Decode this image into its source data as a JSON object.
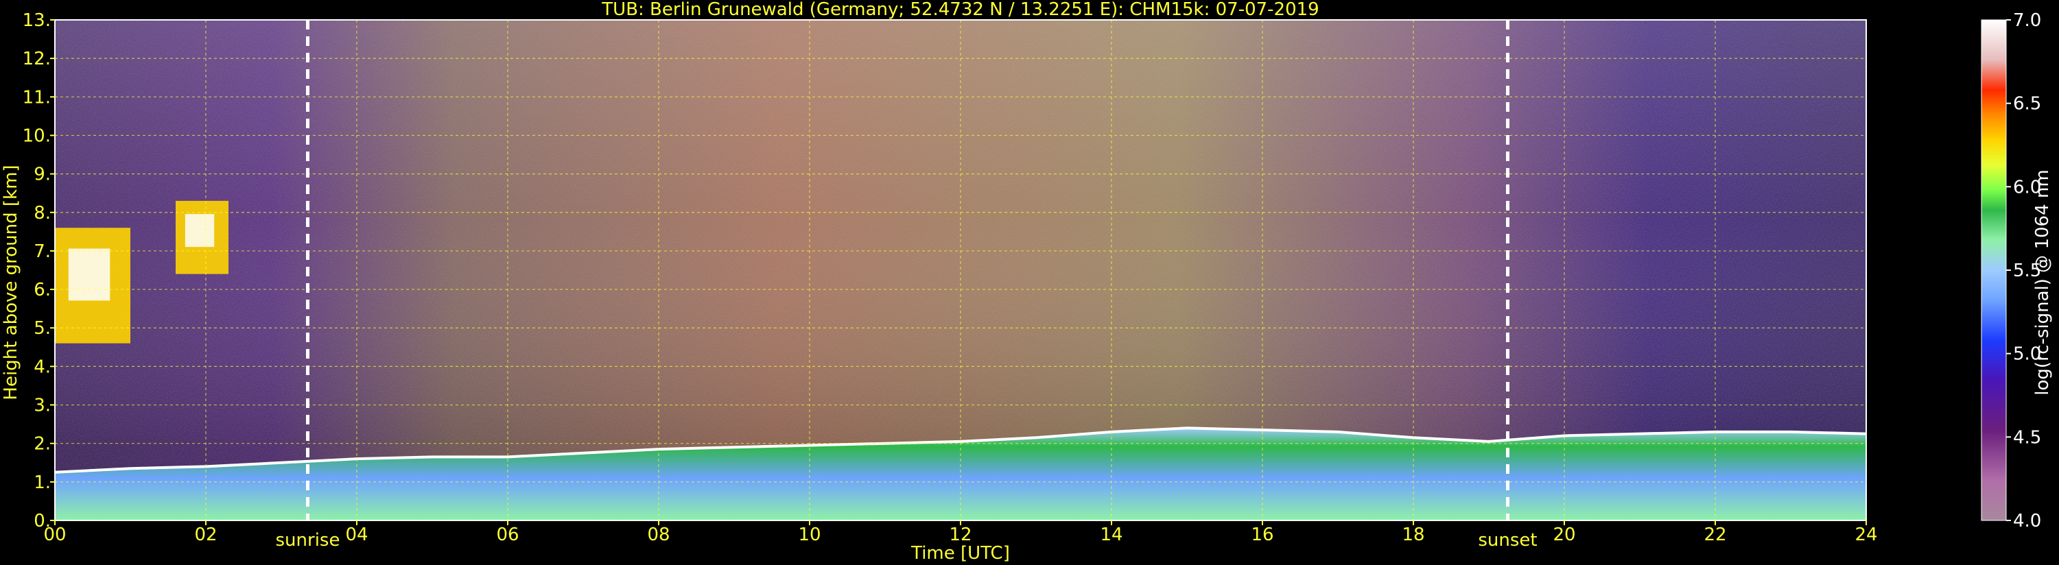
{
  "chart_data": {
    "type": "heatmap",
    "title": "TUB: Berlin Grunewald (Germany; 52.4732 N / 13.2251 E):    CHM15k: 07-07-2019",
    "xlabel": "Time [UTC]",
    "ylabel": "Height above ground [km]",
    "colorbar_label": "log(rc-signal) @ 1064 nm",
    "x": {
      "min": 0,
      "max": 24,
      "ticks": [
        0,
        2,
        4,
        6,
        8,
        10,
        12,
        14,
        16,
        18,
        20,
        22,
        24
      ],
      "tick_labels": [
        "00",
        "02",
        "04",
        "06",
        "08",
        "10",
        "12",
        "14",
        "16",
        "18",
        "20",
        "22",
        "24"
      ]
    },
    "y": {
      "min": 0,
      "max": 13,
      "ticks": [
        0,
        1,
        2,
        3,
        4,
        5,
        6,
        7,
        8,
        9,
        10,
        11,
        12,
        13
      ],
      "tick_labels": [
        "0.",
        "1.",
        "2.",
        "3.",
        "4.",
        "5.",
        "6.",
        "7.",
        "8.",
        "9.",
        "10.",
        "11.",
        "12.",
        "13."
      ]
    },
    "colorbar": {
      "min": 4.0,
      "max": 7.0,
      "ticks": [
        4.0,
        4.5,
        5.0,
        5.5,
        6.0,
        6.5,
        7.0
      ],
      "tick_labels": [
        "4.0",
        "4.5",
        "5.0",
        "5.5",
        "6.0",
        "6.5",
        "7.0"
      ]
    },
    "grid": true,
    "annotations": [
      {
        "label": "sunrise",
        "time": 3.35
      },
      {
        "label": "sunset",
        "time": 19.25
      }
    ],
    "boundary_layer_top": [
      [
        0,
        1.25
      ],
      [
        1,
        1.35
      ],
      [
        2,
        1.4
      ],
      [
        3,
        1.5
      ],
      [
        4,
        1.6
      ],
      [
        5,
        1.65
      ],
      [
        6,
        1.65
      ],
      [
        7,
        1.75
      ],
      [
        8,
        1.85
      ],
      [
        9,
        1.9
      ],
      [
        10,
        1.95
      ],
      [
        11,
        2.0
      ],
      [
        12,
        2.05
      ],
      [
        13,
        2.15
      ],
      [
        14,
        2.3
      ],
      [
        15,
        2.4
      ],
      [
        16,
        2.35
      ],
      [
        17,
        2.3
      ],
      [
        18,
        2.15
      ],
      [
        19,
        2.05
      ],
      [
        20,
        2.2
      ],
      [
        21,
        2.25
      ],
      [
        22,
        2.3
      ],
      [
        23,
        2.3
      ],
      [
        24,
        2.25
      ]
    ],
    "clouds": [
      {
        "time_start": 0.0,
        "time_end": 1.0,
        "base_km": 4.6,
        "top_km": 7.6
      },
      {
        "time_start": 1.6,
        "time_end": 2.3,
        "base_km": 6.4,
        "top_km": 8.3
      }
    ],
    "colors": [
      "#a8899e",
      "#b06ea8",
      "#6b1f7d",
      "#4a16b8",
      "#1d3cff",
      "#6fa4ff",
      "#9ecbff",
      "#8ff0a8",
      "#2fb84a",
      "#0e7d2e",
      "#7cff4a",
      "#e7ff33",
      "#ffd400",
      "#ff8a00",
      "#ff2a00",
      "#e7bcbc",
      "#ffffff"
    ]
  }
}
